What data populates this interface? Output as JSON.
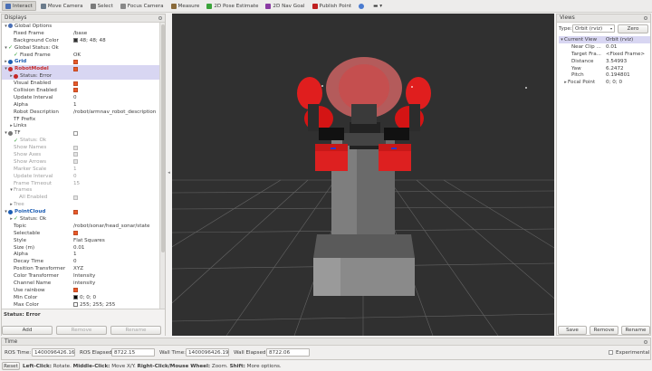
{
  "toolbar": {
    "items": [
      {
        "label": "Interact",
        "icon": "cursor-icon",
        "color": "#4a6fb5"
      },
      {
        "label": "Move Camera",
        "icon": "move-icon",
        "color": "#6b7b8b"
      },
      {
        "label": "Select",
        "icon": "select-icon",
        "color": "#7a7a7a"
      },
      {
        "label": "Focus Camera",
        "icon": "focus-icon",
        "color": "#888888"
      },
      {
        "label": "Measure",
        "icon": "ruler-icon",
        "color": "#8a6a3a"
      },
      {
        "label": "2D Pose Estimate",
        "icon": "arrow-green-icon",
        "color": "#3aa33a"
      },
      {
        "label": "2D Nav Goal",
        "icon": "arrow-purple-icon",
        "color": "#8a3aa3"
      },
      {
        "label": "Publish Point",
        "icon": "pin-icon",
        "color": "#c02020"
      }
    ]
  },
  "displays": {
    "title": "Displays",
    "rows": [
      {
        "depth": 1,
        "arrow": "▾",
        "icon": "gear",
        "name": "Global Options",
        "value": "",
        "cls": ""
      },
      {
        "depth": 2,
        "name": "Fixed Frame",
        "value": "/base"
      },
      {
        "depth": 2,
        "name": "Background Color",
        "value": "48; 48; 48",
        "swatch": "#303030"
      },
      {
        "depth": 1,
        "arrow": "▾",
        "icon": "check",
        "name": "Global Status: Ok",
        "value": ""
      },
      {
        "depth": 2,
        "icon": "check",
        "name": "Fixed Frame",
        "value": "OK"
      },
      {
        "depth": 1,
        "arrow": "▸",
        "icon": "grid",
        "name": "Grid",
        "value": "",
        "cls": "blue bold",
        "cb": "on"
      },
      {
        "depth": 1,
        "arrow": "▾",
        "icon": "error",
        "name": "RobotModel",
        "value": "",
        "cls": "err bold",
        "cb": "on",
        "sel": true
      },
      {
        "depth": 2,
        "arrow": "▸",
        "icon": "error",
        "name": "Status: Error",
        "value": "",
        "sel": true
      },
      {
        "depth": 2,
        "name": "Visual Enabled",
        "value": "",
        "cb": "on"
      },
      {
        "depth": 2,
        "name": "Collision Enabled",
        "value": "",
        "cb": "on"
      },
      {
        "depth": 2,
        "name": "Update Interval",
        "value": "0"
      },
      {
        "depth": 2,
        "name": "Alpha",
        "value": "1"
      },
      {
        "depth": 2,
        "name": "Robot Description",
        "value": "/robot/armnav_robot_description"
      },
      {
        "depth": 2,
        "name": "TF Prefix",
        "value": ""
      },
      {
        "depth": 2,
        "arrow": "▸",
        "name": "Links",
        "value": ""
      },
      {
        "depth": 1,
        "arrow": "▾",
        "icon": "tf",
        "name": "TF",
        "value": "",
        "cb": "off"
      },
      {
        "depth": 2,
        "icon": "check",
        "name": "Status: Ok",
        "value": "",
        "cls": "dis"
      },
      {
        "depth": 2,
        "name": "Show Names",
        "value": "",
        "cls": "dis",
        "cb": "dis"
      },
      {
        "depth": 2,
        "name": "Show Axes",
        "value": "",
        "cls": "dis",
        "cb": "dis"
      },
      {
        "depth": 2,
        "name": "Show Arrows",
        "value": "",
        "cls": "dis",
        "cb": "dis"
      },
      {
        "depth": 2,
        "name": "Marker Scale",
        "value": "1",
        "cls": "dis"
      },
      {
        "depth": 2,
        "name": "Update Interval",
        "value": "0",
        "cls": "dis"
      },
      {
        "depth": 2,
        "name": "Frame Timeout",
        "value": "15",
        "cls": "dis"
      },
      {
        "depth": 2,
        "arrow": "▾",
        "name": "Frames",
        "value": "",
        "cls": "dis"
      },
      {
        "depth": 3,
        "name": "All Enabled",
        "value": "",
        "cls": "dis",
        "cb": "dis"
      },
      {
        "depth": 2,
        "arrow": "▸",
        "name": "Tree",
        "value": "",
        "cls": "dis"
      },
      {
        "depth": 1,
        "arrow": "▾",
        "icon": "cloud",
        "name": "PointCloud",
        "value": "",
        "cls": "blue bold",
        "cb": "on"
      },
      {
        "depth": 2,
        "arrow": "▸",
        "icon": "check",
        "name": "Status: Ok",
        "value": ""
      },
      {
        "depth": 2,
        "name": "Topic",
        "value": "/robot/sonar/head_sonar/state"
      },
      {
        "depth": 2,
        "name": "Selectable",
        "value": "",
        "cb": "on"
      },
      {
        "depth": 2,
        "name": "Style",
        "value": "Flat Squares"
      },
      {
        "depth": 2,
        "name": "Size (m)",
        "value": "0.01"
      },
      {
        "depth": 2,
        "name": "Alpha",
        "value": "1"
      },
      {
        "depth": 2,
        "name": "Decay Time",
        "value": "0"
      },
      {
        "depth": 2,
        "name": "Position Transformer",
        "value": "XYZ"
      },
      {
        "depth": 2,
        "name": "Color Transformer",
        "value": "Intensity"
      },
      {
        "depth": 2,
        "name": "Channel Name",
        "value": "intensity"
      },
      {
        "depth": 2,
        "name": "Use rainbow",
        "value": "",
        "cb": "on"
      },
      {
        "depth": 2,
        "name": "Min Color",
        "value": "0; 0; 0",
        "swatch": "#000000"
      },
      {
        "depth": 2,
        "name": "Max Color",
        "value": "255; 255; 255",
        "swatch": "#ffffff"
      },
      {
        "depth": 2,
        "name": "Autocompute Intensi...",
        "value": "",
        "cb": "on"
      }
    ],
    "status_text": "Status: Error",
    "buttons": {
      "add": "Add",
      "remove": "Remove",
      "rename": "Rename"
    }
  },
  "views": {
    "title": "Views",
    "type_label": "Type:",
    "type_value": "Orbit (rviz)",
    "zero_label": "Zero",
    "header": {
      "name": "Current View",
      "value": "Orbit (rviz)"
    },
    "rows": [
      {
        "name": "Near Clip ...",
        "value": "0.01"
      },
      {
        "name": "Target Fra...",
        "value": "<Fixed Frame>"
      },
      {
        "name": "Distance",
        "value": "3.54993"
      },
      {
        "name": "Yaw",
        "value": "6.2472"
      },
      {
        "name": "Pitch",
        "value": "0.194801"
      },
      {
        "name": "Focal Point",
        "value": "0; 0; 0",
        "arrow": "▸"
      }
    ],
    "buttons": {
      "save": "Save",
      "remove": "Remove",
      "rename": "Rename"
    }
  },
  "time": {
    "title": "Time",
    "ros_time_label": "ROS Time:",
    "ros_time": "1400096426.16",
    "ros_elapsed_label": "ROS Elapsed:",
    "ros_elapsed": "8722.15",
    "wall_time_label": "Wall Time:",
    "wall_time": "1400096426.19",
    "wall_elapsed_label": "Wall Elapsed:",
    "wall_elapsed": "8722.06",
    "experimental_label": "Experimental"
  },
  "statusbar": {
    "reset": "Reset",
    "left_click": "Left-Click:",
    "left_desc": " Rotate. ",
    "middle_click": "Middle-Click:",
    "middle_desc": " Move X/Y. ",
    "right_click": "Right-Click/Mouse Wheel:",
    "right_desc": " Zoom. ",
    "shift": "Shift:",
    "shift_desc": " More options."
  }
}
